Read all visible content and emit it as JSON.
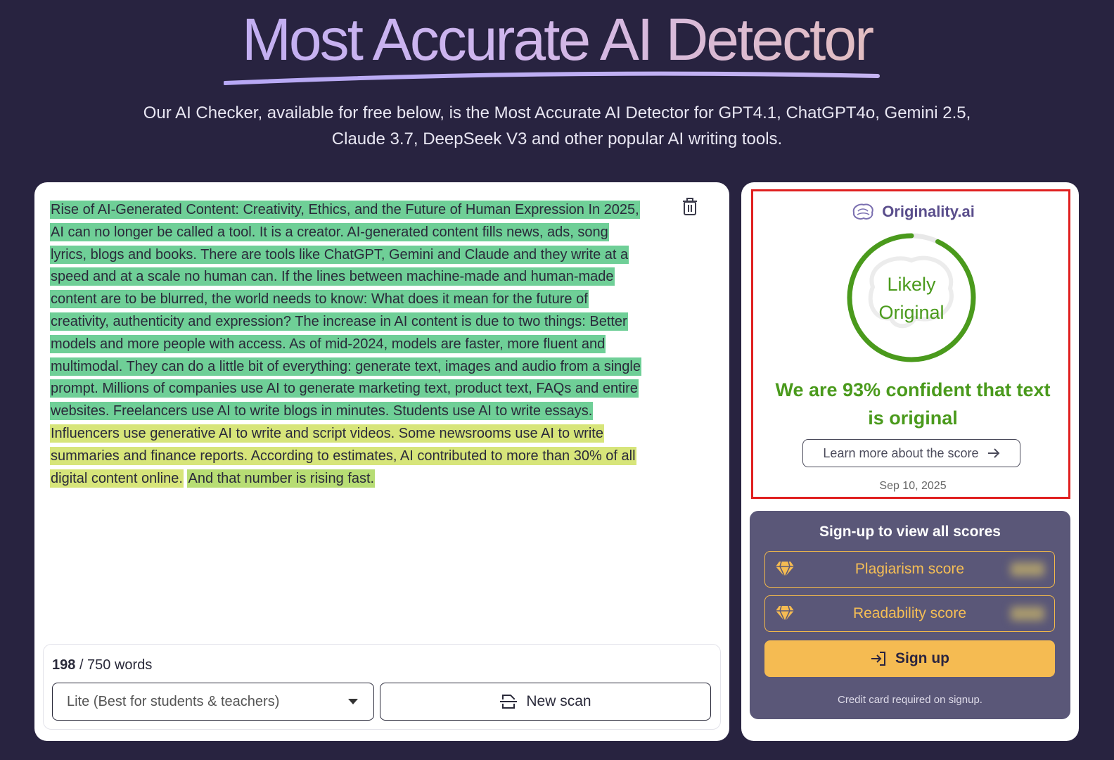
{
  "hero": {
    "title": "Most Accurate AI Detector",
    "subtitle_line1": "Our AI Checker, available for free below, is the Most Accurate AI Detector for GPT4.1, ChatGPT4o, Gemini 2.5,",
    "subtitle_line2": "Claude 3.7, DeepSeek V3 and other popular AI writing tools."
  },
  "editor": {
    "segments": [
      {
        "text": "Rise of AI-Generated Content: Creativity, Ethics, and the Future of Human Expression In 2025, AI can no longer be called a tool. It is a creator. AI-generated content fills news, ads, song lyrics, blogs and books. There are tools like ChatGPT, Gemini and Claude and they write at a speed and at a scale no human can. If the lines between machine-made and human-made content are to be blurred, the world needs to know: What does it mean for the future of creativity, authenticity and expression? The increase in AI content is due to two things: Better models and more people with access. As of mid-2024, models are faster, more fluent and multimodal. They can do a little bit of everything: generate text, images and audio from a single prompt. Millions of companies use AI to generate marketing text, product text, FAQs and entire websites. Freelancers use AI to write blogs in minutes. Students use AI to write essays.",
        "highlight": "green"
      },
      {
        "text": "Influencers use generative AI to write and script videos. Some newsrooms use AI to write summaries and finance reports. According to estimates, AI contributed to more than 30% of all digital content online.",
        "highlight": "yellow"
      },
      {
        "text": "And that number is rising fast.",
        "highlight": "lime"
      }
    ],
    "word_count": "198",
    "word_limit": "/ 750 words",
    "mode_selected": "Lite (Best for students & teachers)",
    "new_scan_label": "New scan"
  },
  "result": {
    "brand": "Originality.ai",
    "gauge_line1": "Likely",
    "gauge_line2": "Original",
    "gauge_value": 0.93,
    "confidence_line1": "We are 93% confident that text",
    "confidence_line2": "is original",
    "learn_more_label": "Learn more about the score",
    "date": "Sep 10, 2025"
  },
  "signup": {
    "title": "Sign-up to view all scores",
    "plagiarism_label": "Plagiarism score",
    "readability_label": "Readability score",
    "button_label": "Sign up",
    "note": "Credit card required on signup."
  },
  "colors": {
    "background": "#282340",
    "green_highlight": "#6fcf97",
    "yellow_highlight": "#d7e57a",
    "success_green": "#4a9a1c",
    "accent_gold": "#f5bb52",
    "frame_red": "#e02020"
  }
}
